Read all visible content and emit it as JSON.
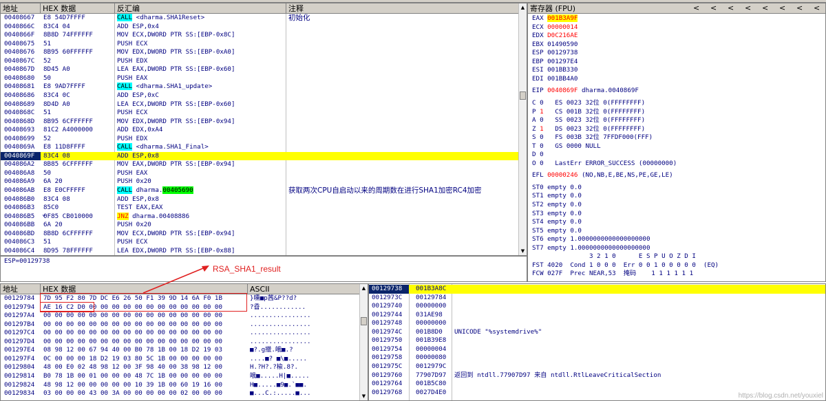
{
  "top_strip_label": "",
  "disasm": {
    "headers": {
      "addr": "地址",
      "hex": "HEX 数据",
      "disasm": "反汇编",
      "comment": "注释"
    },
    "rows": [
      {
        "addr": "00408667",
        "hex": "E8 54D7FFFF",
        "op": "CALL",
        "rest": " <dharma.SHA1Reset>",
        "comment": "初始化",
        "style": "call"
      },
      {
        "addr": "0040866C",
        "hex": "83C4 04",
        "op": "",
        "rest": "ADD ESP,0x4",
        "comment": "",
        "style": ""
      },
      {
        "addr": "0040866F",
        "hex": "8B8D 74FFFFFF",
        "op": "",
        "rest": "MOV ECX,DWORD PTR SS:[EBP-0x8C]",
        "comment": "",
        "style": ""
      },
      {
        "addr": "00408675",
        "hex": "51",
        "op": "",
        "rest": "PUSH ECX",
        "comment": "",
        "style": ""
      },
      {
        "addr": "00408676",
        "hex": "8B95 60FFFFFF",
        "op": "",
        "rest": "MOV EDX,DWORD PTR SS:[EBP-0xA0]",
        "comment": "",
        "style": ""
      },
      {
        "addr": "0040867C",
        "hex": "52",
        "op": "",
        "rest": "PUSH EDX",
        "comment": "",
        "style": ""
      },
      {
        "addr": "0040867D",
        "hex": "8D45 A0",
        "op": "",
        "rest": "LEA EAX,DWORD PTR SS:[EBP-0x60]",
        "comment": "",
        "style": ""
      },
      {
        "addr": "00408680",
        "hex": "50",
        "op": "",
        "rest": "PUSH EAX",
        "comment": "",
        "style": ""
      },
      {
        "addr": "00408681",
        "hex": "E8 9AD7FFFF",
        "op": "CALL",
        "rest": " <dharma.SHA1_update>",
        "comment": "",
        "style": "call"
      },
      {
        "addr": "00408686",
        "hex": "83C4 0C",
        "op": "",
        "rest": "ADD ESP,0xC",
        "comment": "",
        "style": ""
      },
      {
        "addr": "00408689",
        "hex": "8D4D A0",
        "op": "",
        "rest": "LEA ECX,DWORD PTR SS:[EBP-0x60]",
        "comment": "",
        "style": ""
      },
      {
        "addr": "0040868C",
        "hex": "51",
        "op": "",
        "rest": "PUSH ECX",
        "comment": "",
        "style": ""
      },
      {
        "addr": "0040868D",
        "hex": "8B95 6CFFFFFF",
        "op": "",
        "rest": "MOV EDX,DWORD PTR SS:[EBP-0x94]",
        "comment": "",
        "style": ""
      },
      {
        "addr": "00408693",
        "hex": "81C2 A4000000",
        "op": "",
        "rest": "ADD EDX,0xA4",
        "comment": "",
        "style": ""
      },
      {
        "addr": "00408699",
        "hex": "52",
        "op": "",
        "rest": "PUSH EDX",
        "comment": "",
        "style": ""
      },
      {
        "addr": "0040869A",
        "hex": "E8 11D8FFFF",
        "op": "CALL",
        "rest": " <dharma.SHA1_Final>",
        "comment": "",
        "style": "call"
      },
      {
        "addr": "0040869F",
        "hex": "83C4 08",
        "op": "",
        "rest": "ADD ESP,0x8",
        "comment": "",
        "style": "sel"
      },
      {
        "addr": "004086A2",
        "hex": "8B85 6CFFFFFF",
        "op": "",
        "rest": "MOV EAX,DWORD PTR SS:[EBP-0x94]",
        "comment": "",
        "style": ""
      },
      {
        "addr": "004086A8",
        "hex": "50",
        "op": "",
        "rest": "PUSH EAX",
        "comment": "",
        "style": ""
      },
      {
        "addr": "004086A9",
        "hex": "6A 20",
        "op": "",
        "rest": "PUSH 0x20",
        "comment": "",
        "style": ""
      },
      {
        "addr": "004086AB",
        "hex": "E8 E0CFFFFF",
        "op": "CALL",
        "rest": " dharma.",
        "tail": "00405690",
        "comment": "获取两次CPU自启动以来的周期数在进行SHA1加密RC4加密",
        "style": "call"
      },
      {
        "addr": "004086B0",
        "hex": "83C4 08",
        "op": "",
        "rest": "ADD ESP,0x8",
        "comment": "",
        "style": ""
      },
      {
        "addr": "004086B3",
        "hex": "85C0",
        "op": "",
        "rest": "TEST EAX,EAX",
        "comment": "",
        "style": ""
      },
      {
        "addr": "004086B5",
        "hex": "0F85 CB010000",
        "op": "JNZ",
        "rest": " dharma.00408886",
        "comment": "",
        "style": "jnz"
      },
      {
        "addr": "004086BB",
        "hex": "6A 20",
        "op": "",
        "rest": "PUSH 0x20",
        "comment": "",
        "style": ""
      },
      {
        "addr": "004086BD",
        "hex": "8B8D 6CFFFFFF",
        "op": "",
        "rest": "MOV ECX,DWORD PTR SS:[EBP-0x94]",
        "comment": "",
        "style": ""
      },
      {
        "addr": "004086C3",
        "hex": "51",
        "op": "",
        "rest": "PUSH ECX",
        "comment": "",
        "style": ""
      },
      {
        "addr": "004086C4",
        "hex": "8D95 78FFFFFF",
        "op": "",
        "rest": "LEA EDX,DWORD PTR SS:[EBP-0x88]",
        "comment": "",
        "style": ""
      }
    ],
    "status": "ESP=00129738"
  },
  "registers": {
    "header": "寄存器 (FPU)",
    "chevrons": [
      "<",
      "<",
      "<",
      "<",
      "<",
      "<",
      "<",
      "<"
    ],
    "gp": [
      {
        "name": "EAX",
        "val": "001B3A9F",
        "extra": "",
        "hl": "sel"
      },
      {
        "name": "ECX",
        "val": "00000014",
        "extra": "",
        "hl": "red"
      },
      {
        "name": "EDX",
        "val": "D0C216AE",
        "extra": "",
        "hl": "red"
      },
      {
        "name": "EBX",
        "val": "01490590",
        "extra": "",
        "hl": ""
      },
      {
        "name": "ESP",
        "val": "00129738",
        "extra": "",
        "hl": ""
      },
      {
        "name": "EBP",
        "val": "001297E4",
        "extra": "",
        "hl": ""
      },
      {
        "name": "ESI",
        "val": "001BB330",
        "extra": "",
        "hl": ""
      },
      {
        "name": "EDI",
        "val": "001BB4A0",
        "extra": "",
        "hl": ""
      }
    ],
    "eip": {
      "name": "EIP",
      "val": "0040869F",
      "extra": " dharma.0040869F"
    },
    "flags": [
      {
        "f": "C",
        "v": "0",
        "seg": "ES",
        "sel": "0023",
        "txt": "32位 0(FFFFFFFF)",
        "hl": false
      },
      {
        "f": "P",
        "v": "1",
        "seg": "CS",
        "sel": "001B",
        "txt": "32位 0(FFFFFFFF)",
        "hl": true
      },
      {
        "f": "A",
        "v": "0",
        "seg": "SS",
        "sel": "0023",
        "txt": "32位 0(FFFFFFFF)",
        "hl": false
      },
      {
        "f": "Z",
        "v": "1",
        "seg": "DS",
        "sel": "0023",
        "txt": "32位 0(FFFFFFFF)",
        "hl": true
      },
      {
        "f": "S",
        "v": "0",
        "seg": "FS",
        "sel": "003B",
        "txt": "32位 7FFDF000(FFF)",
        "hl": false
      },
      {
        "f": "T",
        "v": "0",
        "seg": "GS",
        "sel": "0000",
        "txt": "NULL",
        "hl": false
      },
      {
        "f": "D",
        "v": "0",
        "seg": "",
        "sel": "",
        "txt": "",
        "hl": false
      },
      {
        "f": "O",
        "v": "0",
        "seg": "",
        "sel": "",
        "txt": "LastErr ERROR_SUCCESS (00000000)",
        "hl": false
      }
    ],
    "efl": {
      "name": "EFL",
      "val": "00000246",
      "extra": " (NO,NB,E,BE,NS,PE,GE,LE)"
    },
    "fpu": [
      "ST0 empty 0.0",
      "ST1 empty 0.0",
      "ST2 empty 0.0",
      "ST3 empty 0.0",
      "ST4 empty 0.0",
      "ST5 empty 0.0",
      "ST6 empty 1.0000000000000000000",
      "ST7 empty 1.0000000000000000000"
    ],
    "fpu_bits_header": "               3 2 1 0      E S P U O Z D I",
    "fst": "FST 4020  Cond 1 0 0 0  Err 0 0 1 0 0 0 0 0  (EQ)",
    "fcw": "FCW 027F  Prec NEAR,53  掩码    1 1 1 1 1 1"
  },
  "dump": {
    "headers": {
      "addr": "地址",
      "hex": "HEX 数据",
      "ascii": "ASCII"
    },
    "rows": [
      {
        "addr": "00129784",
        "hex": "7D 95 F2 80 7D DC E6 26 50 F1 39 9D 14 6A F0 1B",
        "ascii": "}曛■p茜&P??d?"
      },
      {
        "addr": "00129794",
        "hex": "AE 16 C2 D0 00 00 00 00 00 00 00 00 00 00 00 00",
        "ascii": "?孴............"
      },
      {
        "addr": "001297A4",
        "hex": "00 00 00 00 00 00 00 00 00 00 00 00 00 00 00 00",
        "ascii": "................"
      },
      {
        "addr": "001297B4",
        "hex": "00 00 00 00 00 00 00 00 00 00 00 00 00 00 00 00",
        "ascii": "................"
      },
      {
        "addr": "001297C4",
        "hex": "00 00 00 00 00 00 00 00 00 00 00 00 00 00 00 00",
        "ascii": "................"
      },
      {
        "addr": "001297D4",
        "hex": "00 00 00 00 00 00 00 00 00 00 00 00 00 00 00 00",
        "ascii": "................"
      },
      {
        "addr": "001297E4",
        "hex": "08 98 12 00 67 94 40 00 B0 78 1B 00 18 D2 19 03",
        "ascii": "■?.g擸.皒■.?"
      },
      {
        "addr": "001297F4",
        "hex": "0C 00 00 00 18 D2 19 03 80 5C 1B 00 00 00 00 00",
        "ascii": "....■? ■\\■....."
      },
      {
        "addr": "00129804",
        "hex": "48 00 E0 02 48 98 12 00 3F 98 40 00 38 98 12 00",
        "ascii": "H.?H?.?楡.8?."
      },
      {
        "addr": "00129814",
        "hex": "B0 78 1B 00 01 00 00 00 48 7C 1B 00 00 00 00 00",
        "ascii": "皒■.....H|■....."
      },
      {
        "addr": "00129824",
        "hex": "48 98 12 00 00 00 00 00 10 39 1B 00 60 19 16 00",
        "ascii": "H■.....■9■.`■■."
      },
      {
        "addr": "00129834",
        "hex": "03 00 00 00 43 00 3A 00 00 00 00 00 02 00 00 00",
        "ascii": "■...C.:.....■..."
      }
    ]
  },
  "stack": {
    "rows": [
      {
        "addr": "00129738",
        "val": "001B3A8C",
        "comment": "",
        "sel": true
      },
      {
        "addr": "0012973C",
        "val": "00129784",
        "comment": "",
        "sel": false
      },
      {
        "addr": "00129740",
        "val": "00000000",
        "comment": "",
        "sel": false
      },
      {
        "addr": "00129744",
        "val": "031AE98",
        "comment": "",
        "sel": false
      },
      {
        "addr": "00129748",
        "val": "00000000",
        "comment": "",
        "sel": false
      },
      {
        "addr": "0012974C",
        "val": "001B8D0",
        "comment": "UNICODE \"%systemdrive%\"",
        "sel": false
      },
      {
        "addr": "00129750",
        "val": "001B39E8",
        "comment": "",
        "sel": false
      },
      {
        "addr": "00129754",
        "val": "00000004",
        "comment": "",
        "sel": false
      },
      {
        "addr": "00129758",
        "val": "00000080",
        "comment": "",
        "sel": false
      },
      {
        "addr": "0012975C",
        "val": "0012979C",
        "comment": "",
        "sel": false
      },
      {
        "addr": "00129760",
        "val": "77907D97",
        "comment": "返回到 ntdll.77907D97 来自 ntdll.RtlLeaveCriticalSection",
        "sel": false
      },
      {
        "addr": "00129764",
        "val": "001B5C80",
        "comment": "",
        "sel": false
      },
      {
        "addr": "00129768",
        "val": "0027D4E0",
        "comment": "",
        "sel": false
      }
    ]
  },
  "annotation": {
    "label": "RSA_SHA1_result"
  },
  "watermark": "https://blog.csdn.net/youxiel"
}
